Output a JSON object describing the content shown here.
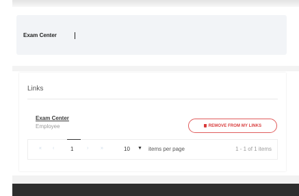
{
  "search": {
    "value": "Exam Center"
  },
  "links": {
    "title": "Links",
    "items": [
      {
        "name": "Exam Center",
        "subtitle": "Employee",
        "action_label": "REMOVE FROM MY LINKS"
      }
    ]
  },
  "pagination": {
    "first_glyph": "«",
    "prev_glyph": "‹",
    "current_page": "1",
    "next_glyph": "›",
    "last_glyph": "»",
    "page_size": "10",
    "dropdown_glyph": "▼",
    "items_per_page_label": "items per page",
    "range_text": "1 - 1 of 1 items"
  },
  "colors": {
    "accent_red": "#d83a3a",
    "input_bg": "#f2f4f7"
  }
}
